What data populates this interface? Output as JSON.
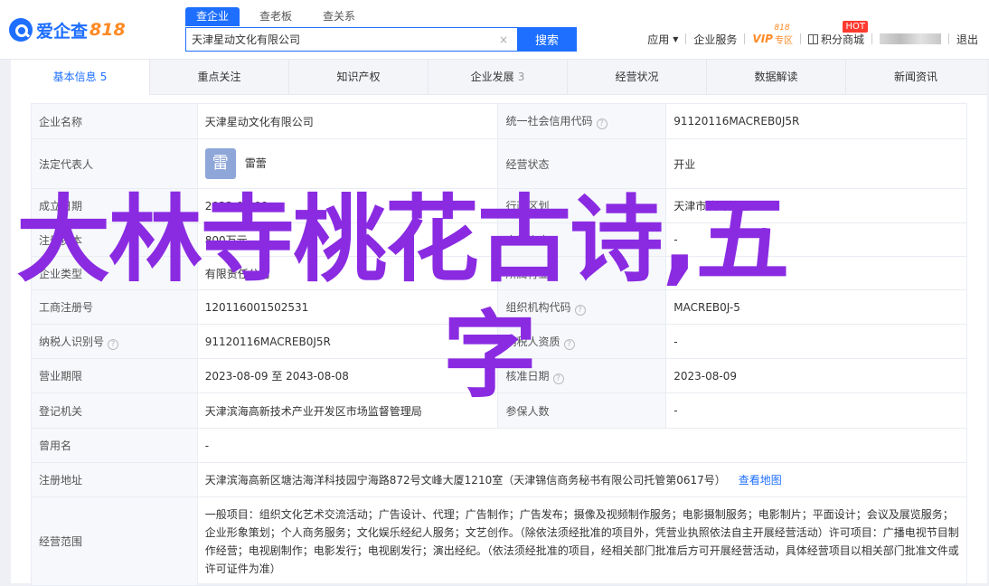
{
  "header": {
    "logo_text": "爱企查",
    "logo_num": "818",
    "search_tabs": [
      {
        "label": "查企业"
      },
      {
        "label": "查老板"
      },
      {
        "label": "查关系"
      }
    ],
    "search_value": "天津星动文化有限公司",
    "clear_glyph": "×",
    "search_button": "搜索",
    "nav": {
      "app": "应用",
      "service": "企业服务",
      "vip": "VIP",
      "vip_sub": "专区",
      "vip_818": "818",
      "hot": "HOT",
      "points": "积分商城",
      "logout": "退出"
    }
  },
  "tabs": [
    {
      "label": "基本信息",
      "count": "5"
    },
    {
      "label": "重点关注",
      "count": ""
    },
    {
      "label": "知识产权",
      "count": ""
    },
    {
      "label": "企业发展",
      "count": "3"
    },
    {
      "label": "经营状况",
      "count": ""
    },
    {
      "label": "数据解读",
      "count": ""
    },
    {
      "label": "新闻资讯",
      "count": ""
    }
  ],
  "info": {
    "r1": {
      "l1": "企业名称",
      "v1": "天津星动文化有限公司",
      "l2": "统一社会信用代码",
      "v2": "91120116MACREB0J5R"
    },
    "r2": {
      "l1": "法定代表人",
      "avatar": "雷",
      "v1": "雷蕾",
      "l2": "经营状态",
      "v2": "开业"
    },
    "r3": {
      "l1": "成立日期",
      "v1": "2023-08-09",
      "l2": "行政区划",
      "v2": "天津市滨海新区"
    },
    "r4": {
      "l1": "注册资本",
      "v1": "800万元",
      "l2": "实缴资本",
      "v2": "-"
    },
    "r5": {
      "l1": "企业类型",
      "v1": "有限责任公司",
      "l2": "所属行业",
      "v2": "-"
    },
    "r6": {
      "l1": "工商注册号",
      "v1": "120116001502531",
      "l2": "组织机构代码",
      "v2": "MACREB0J-5"
    },
    "r7": {
      "l1": "纳税人识别号",
      "v1": "91120116MACREB0J5R",
      "l2": "纳税人资质",
      "v2": "-"
    },
    "r8": {
      "l1": "营业期限",
      "v1": "2023-08-09 至 2043-08-08",
      "l2": "核准日期",
      "v2": "2023-08-09"
    },
    "r9": {
      "l1": "登记机关",
      "v1": "天津滨海高新技术产业开发区市场监督管理局",
      "l2": "参保人数",
      "v2": "-"
    },
    "r10": {
      "l1": "曾用名",
      "v1": "-"
    },
    "r11": {
      "l1": "注册地址",
      "v1": "天津滨海高新区塘沽海洋科技园宁海路872号文峰大厦1210室（天津锦信商务秘书有限公司托管第0617号）",
      "map": "查看地图"
    },
    "r12": {
      "l1": "经营范围",
      "v1": "一般项目：组织文化艺术交流活动；广告设计、代理；广告制作；广告发布；摄像及视频制作服务；电影摄制服务；电影制片；平面设计；会议及展览服务；企业形象策划；个人商务服务；文化娱乐经纪人服务；文艺创作。（除依法须经批准的项目外，凭营业执照依法自主开展经营活动）许可项目：广播电视节目制作经营；电视剧制作；电影发行；电视剧发行；演出经纪。（依法须经批准的项目，经相关部门批准后方可开展经营活动，具体经营项目以相关部门批准文件或许可证件为准）"
    }
  },
  "overlay": {
    "line1": "大林寺桃花古诗,五",
    "line2": "字"
  }
}
